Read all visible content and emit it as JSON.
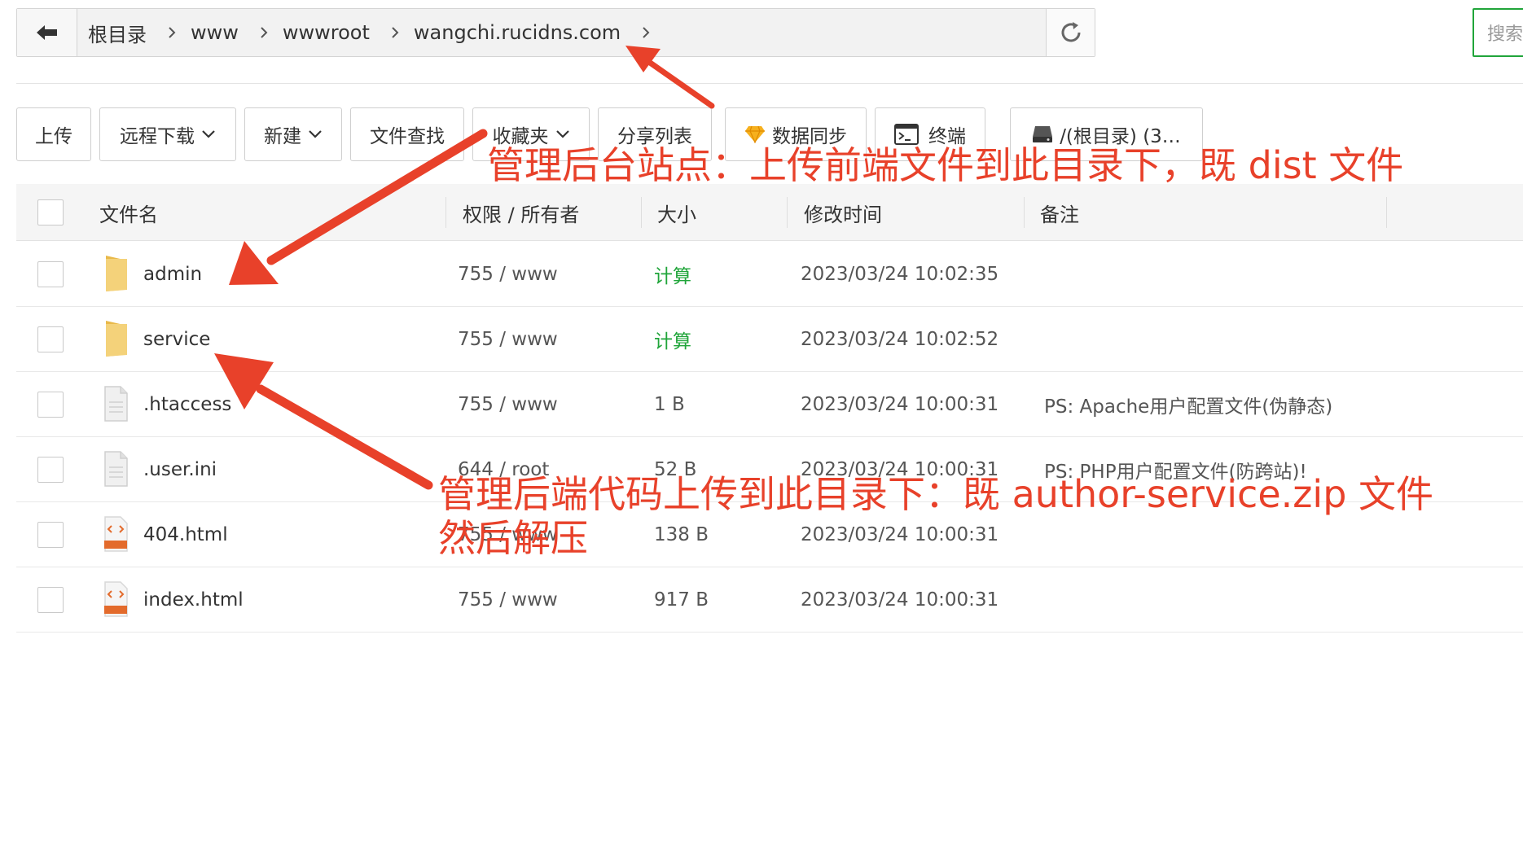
{
  "breadcrumb": {
    "items": [
      "根目录",
      "www",
      "wwwroot",
      "wangchi.rucidns.com"
    ]
  },
  "search": {
    "placeholder": "搜索"
  },
  "toolbar": {
    "upload": "上传",
    "remote_download": "远程下载",
    "new": "新建",
    "file_search": "文件查找",
    "favorites": "收藏夹",
    "share_list": "分享列表",
    "data_sync": "数据同步",
    "terminal": "终端",
    "disk": "/(根目录) (3…"
  },
  "table": {
    "headers": {
      "name": "文件名",
      "perm": "权限 / 所有者",
      "size": "大小",
      "mtime": "修改时间",
      "note": "备注"
    },
    "rows": [
      {
        "type": "folder",
        "name": "admin",
        "perm": "755 / www",
        "size": "计算",
        "mtime": "2023/03/24 10:02:35",
        "note": ""
      },
      {
        "type": "folder",
        "name": "service",
        "perm": "755 / www",
        "size": "计算",
        "mtime": "2023/03/24 10:02:52",
        "note": ""
      },
      {
        "type": "file",
        "name": ".htaccess",
        "perm": "755 / www",
        "size": "1 B",
        "mtime": "2023/03/24 10:00:31",
        "note": "PS: Apache用户配置文件(伪静态)"
      },
      {
        "type": "file",
        "name": ".user.ini",
        "perm": "644 / root",
        "size": "52 B",
        "mtime": "2023/03/24 10:00:31",
        "note": "PS: PHP用户配置文件(防跨站)!"
      },
      {
        "type": "html",
        "name": "404.html",
        "perm": "755 / www",
        "size": "138 B",
        "mtime": "2023/03/24 10:00:31",
        "note": ""
      },
      {
        "type": "html",
        "name": "index.html",
        "perm": "755 / www",
        "size": "917 B",
        "mtime": "2023/03/24 10:00:31",
        "note": ""
      }
    ]
  },
  "annotations": {
    "admin_note": "管理后台站点：上传前端文件到此目录下，既 dist 文件",
    "service_note_line1": "管理后端代码上传到此目录下：既 author-service.zip 文件",
    "service_note_line2": "然后解压"
  },
  "icons": {
    "back": "arrow-left-icon",
    "refresh": "refresh-icon",
    "folder": "folder-icon",
    "file": "file-icon",
    "html": "html-file-icon",
    "data_sync": "diamond-icon",
    "terminal": "terminal-icon",
    "disk": "disk-icon"
  },
  "colors": {
    "accent_green": "#20a53a",
    "annotation_red": "#e8412a",
    "folder_yellow": "#f4d27a"
  }
}
